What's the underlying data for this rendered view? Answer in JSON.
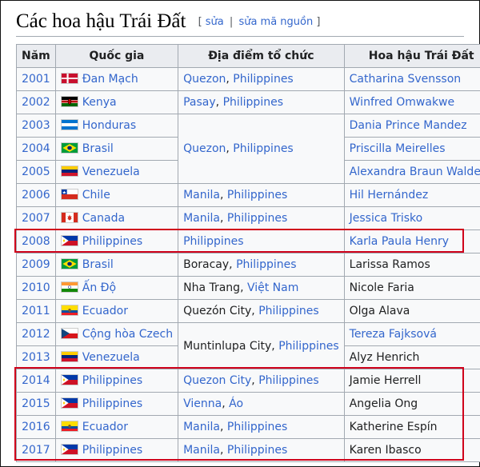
{
  "heading": {
    "title": "Các hoa hậu Trái Đất",
    "edit_open": "[",
    "edit_label": "sửa",
    "edit_sep": "|",
    "edit_source_label": "sửa mã nguồn",
    "edit_close": "]"
  },
  "table": {
    "headers": [
      "Năm",
      "Quốc gia",
      "Địa điểm tổ chức",
      "Hoa hậu Trái Đất"
    ],
    "rows": [
      {
        "year": "2001",
        "country": "Đan Mạch",
        "flag": "denmark-flag-icon",
        "venue": {
          "parts": [
            "Quezon",
            ", ",
            "Philippines"
          ]
        },
        "winner": "Catharina Svensson"
      },
      {
        "year": "2002",
        "country": "Kenya",
        "flag": "kenya-flag-icon",
        "venue": {
          "parts": [
            "Pasay",
            ", ",
            "Philippines"
          ]
        },
        "winner": "Winfred Omwakwe"
      },
      {
        "year": "2003",
        "country": "Honduras",
        "flag": "honduras-flag-icon",
        "venue": {
          "parts": [
            "Quezon",
            ", ",
            "Philippines"
          ]
        },
        "winner": "Dania Prince Mandez"
      },
      {
        "year": "2004",
        "country": "Brasil",
        "flag": "brazil-flag-icon",
        "winner": "Priscilla Meirelles"
      },
      {
        "year": "2005",
        "country": "Venezuela",
        "flag": "venezuela-flag-icon",
        "winner": "Alexandra Braun Waldeck"
      },
      {
        "year": "2006",
        "country": "Chile",
        "flag": "chile-flag-icon",
        "venue": {
          "parts": [
            "Manila",
            ", ",
            "Philippines"
          ]
        },
        "winner": "Hil Hernández"
      },
      {
        "year": "2007",
        "country": "Canada",
        "flag": "canada-flag-icon",
        "venue": {
          "parts": [
            "Manila",
            ", ",
            "Philippines"
          ]
        },
        "winner": "Jessica Trisko"
      },
      {
        "year": "2008",
        "country": "Philippines",
        "flag": "philippines-flag-icon",
        "venue": {
          "parts": [
            "Philippines"
          ]
        },
        "winner": "Karla Paula Henry"
      },
      {
        "year": "2009",
        "country": "Brasil",
        "flag": "brazil-flag-icon",
        "venue": {
          "parts": [
            "Boracay",
            ", ",
            "Philippines"
          ]
        },
        "winner": "Larissa Ramos"
      },
      {
        "year": "2010",
        "country": "Ấn Độ",
        "flag": "india-flag-icon",
        "venue": {
          "parts": [
            "Nha Trang",
            ", ",
            "Việt Nam"
          ]
        },
        "winner": "Nicole Faria"
      },
      {
        "year": "2011",
        "country": "Ecuador",
        "flag": "ecuador-flag-icon",
        "venue": {
          "parts": [
            "Quezón City",
            ", ",
            "Philippines"
          ]
        },
        "winner": "Olga Alava"
      },
      {
        "year": "2012",
        "country": "Cộng hòa Czech",
        "flag": "czech-flag-icon",
        "venue": {
          "parts": [
            "Muntinlupa City",
            ", ",
            "Philippines"
          ]
        },
        "winner": "Tereza Fajksová"
      },
      {
        "year": "2013",
        "country": "Venezuela",
        "flag": "venezuela-flag-icon",
        "winner": "Alyz Henrich"
      },
      {
        "year": "2014",
        "country": "Philippines",
        "flag": "philippines-flag-icon",
        "venue": {
          "parts": [
            "Quezon City",
            ", ",
            "Philippines"
          ]
        },
        "winner": "Jamie Herrell"
      },
      {
        "year": "2015",
        "country": "Philippines",
        "flag": "philippines-flag-icon",
        "venue": {
          "parts": [
            "Vienna",
            ", ",
            "Áo"
          ]
        },
        "winner": "Angelia Ong"
      },
      {
        "year": "2016",
        "country": "Ecuador",
        "flag": "ecuador-flag-icon",
        "venue": {
          "parts": [
            "Manila",
            ", ",
            "Philippines"
          ]
        },
        "winner": "Katherine Espín"
      },
      {
        "year": "2017",
        "country": "Philippines",
        "flag": "philippines-flag-icon",
        "venue": {
          "parts": [
            "Manila",
            ", ",
            "Philippines"
          ]
        },
        "winner": "Karen Ibasco"
      }
    ]
  },
  "colors": {
    "link": "#3366cc",
    "highlight_box": "#d0021b",
    "header_bg": "#eaecf0",
    "cell_bg": "#f8f9fa",
    "border": "#a2a9b1"
  }
}
